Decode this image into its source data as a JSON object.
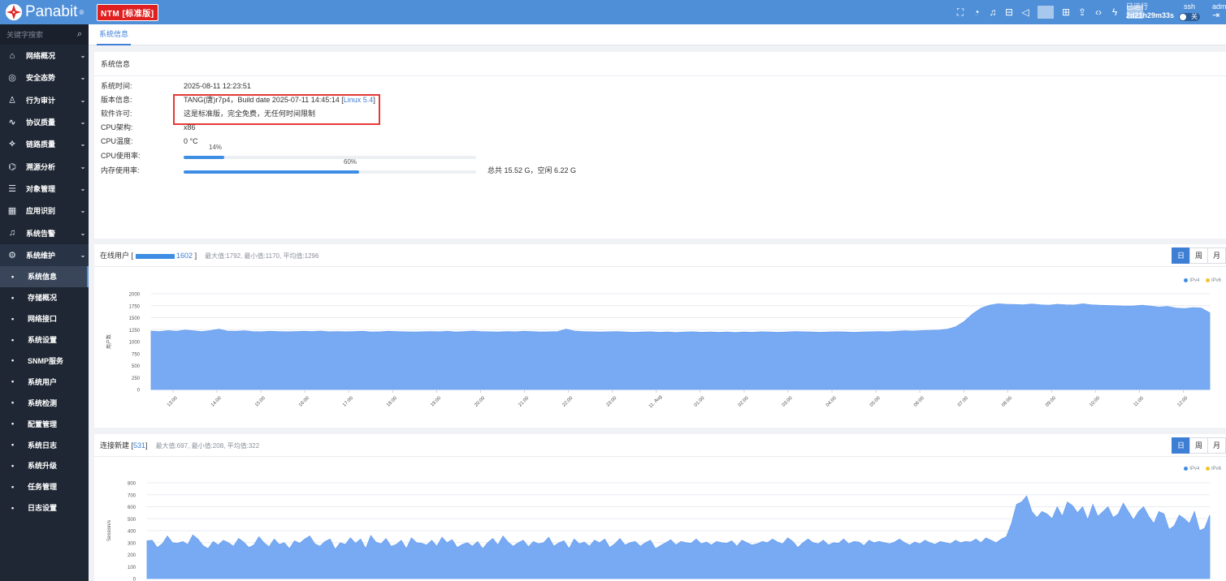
{
  "brand": {
    "name": "Panabit",
    "mark": "®",
    "edition": "NTM [标准版]"
  },
  "top": {
    "uptime_label": "已运行",
    "uptime_value": "2d21h29m33s",
    "ssh_label": "ssh",
    "ssh_toggle": "关",
    "admin_label": "adm"
  },
  "sidebar": {
    "search_placeholder": "关键字搜索",
    "items": [
      {
        "label": "网络概况",
        "icon": "home-icon"
      },
      {
        "label": "安全态势",
        "icon": "globe-icon"
      },
      {
        "label": "行为审计",
        "icon": "user-icon"
      },
      {
        "label": "协议质量",
        "icon": "pulse-icon"
      },
      {
        "label": "链路质量",
        "icon": "network-icon"
      },
      {
        "label": "溯源分析",
        "icon": "radar-icon"
      },
      {
        "label": "对象管理",
        "icon": "database-icon"
      },
      {
        "label": "应用识别",
        "icon": "apps-icon"
      },
      {
        "label": "系统告警",
        "icon": "bell-icon"
      },
      {
        "label": "系统维护",
        "icon": "gear-icon"
      }
    ],
    "subitems": [
      "系统信息",
      "存储概况",
      "网络接口",
      "系统设置",
      "SNMP服务",
      "系统用户",
      "系统检测",
      "配置管理",
      "系统日志",
      "系统升级",
      "任务管理",
      "日志设置"
    ]
  },
  "tabs": [
    "系统信息"
  ],
  "system_info": {
    "title": "系统信息",
    "labels": [
      "系统时间:",
      "版本信息:",
      "软件许可:",
      "CPU架构:",
      "CPU温度:",
      "CPU使用率:",
      "内存使用率:"
    ],
    "system_time": "2025-08-11 12:23:51",
    "version_prefix": "TANG(唐)r7p4，Build date 2025-07-11 14:45:14 [",
    "version_kernel": "Linux 5.4",
    "version_suffix": "]",
    "license": "这是标准版，完全免费，无任何时间限制",
    "cpu_arch": "x86",
    "cpu_temp": "0 °C",
    "cpu_usage": 14,
    "cpu_usage_label": "14%",
    "mem_usage": 60,
    "mem_usage_label": "60%",
    "mem_summary": "总共 15.52 G，空闲 6.22 G"
  },
  "online_users": {
    "title": "在线用户 [",
    "current": "1602",
    "close": "]",
    "stats": "最大值:1792, 最小值:1170, 平均值:1296",
    "period_buttons": [
      "日",
      "周",
      "月"
    ],
    "active_period": "日",
    "legend": [
      "IPv4",
      "IPv6"
    ],
    "ylabel": "用户数",
    "colors": {
      "ipv4": "#3d8de4",
      "ipv6": "#f4c430",
      "area": "#78aaf3"
    }
  },
  "new_connections": {
    "title": "连接新建 [",
    "current": "531",
    "close": "]",
    "stats": "最大值:697, 最小值:208, 平均值:322",
    "period_buttons": [
      "日",
      "周",
      "月"
    ],
    "active_period": "日",
    "legend": [
      "IPv4",
      "IPv6"
    ],
    "ylabel": "Session/s"
  },
  "chart_data": [
    {
      "type": "area",
      "title": "",
      "xlabel": "",
      "ylabel": "用户数",
      "ylim": [
        0,
        2000
      ],
      "y_ticks": [
        0,
        250,
        500,
        750,
        1000,
        1250,
        1500,
        1750,
        2000
      ],
      "x_ticks": [
        "13:00",
        "14:00",
        "15:00",
        "16:00",
        "17:00",
        "18:00",
        "19:00",
        "20:00",
        "21:00",
        "22:00",
        "23:00",
        "11. Aug",
        "01:00",
        "02:00",
        "03:00",
        "04:00",
        "05:00",
        "06:00",
        "07:00",
        "08:00",
        "09:00",
        "10:00",
        "11:00",
        "12:00"
      ],
      "series": [
        {
          "name": "IPv4",
          "values": [
            1220,
            1210,
            1230,
            1215,
            1240,
            1225,
            1210,
            1230,
            1260,
            1220,
            1215,
            1225,
            1210,
            1205,
            1215,
            1210,
            1205,
            1210,
            1215,
            1210,
            1220,
            1205,
            1210,
            1205,
            1210,
            1215,
            1200,
            1205,
            1215,
            1210,
            1205,
            1200,
            1205,
            1210,
            1205,
            1215,
            1200,
            1210,
            1220,
            1210,
            1205,
            1200,
            1210,
            1205,
            1215,
            1210,
            1200,
            1205,
            1210,
            1260,
            1220,
            1210,
            1205,
            1200,
            1205,
            1210,
            1200,
            1195,
            1200,
            1205,
            1195,
            1200,
            1190,
            1200,
            1205,
            1195,
            1200,
            1195,
            1200,
            1190,
            1200,
            1195,
            1205,
            1200,
            1195,
            1200,
            1210,
            1205,
            1200,
            1195,
            1200,
            1205,
            1200,
            1195,
            1200,
            1205,
            1210,
            1205,
            1215,
            1225,
            1220,
            1230,
            1235,
            1240,
            1260,
            1310,
            1420,
            1580,
            1700,
            1760,
            1790,
            1780,
            1775,
            1770,
            1785,
            1770,
            1760,
            1780,
            1770,
            1765,
            1790,
            1770,
            1760,
            1755,
            1750,
            1740,
            1745,
            1760,
            1740,
            1720,
            1735,
            1700,
            1690,
            1710,
            1700,
            1602
          ]
        },
        {
          "name": "IPv6",
          "values": []
        }
      ]
    },
    {
      "type": "area",
      "title": "",
      "xlabel": "",
      "ylabel": "Session/s",
      "ylim": [
        0,
        800
      ],
      "y_ticks": [
        0,
        100,
        200,
        300,
        400,
        500,
        600,
        700,
        800
      ],
      "x_ticks": [],
      "series": [
        {
          "name": "IPv4",
          "values": [
            315,
            320,
            260,
            290,
            355,
            300,
            295,
            310,
            285,
            365,
            330,
            275,
            250,
            310,
            280,
            320,
            300,
            270,
            335,
            305,
            260,
            280,
            350,
            300,
            265,
            330,
            285,
            300,
            250,
            315,
            295,
            330,
            355,
            290,
            270,
            310,
            330,
            245,
            300,
            285,
            340,
            295,
            330,
            250,
            360,
            305,
            290,
            335,
            270,
            285,
            320,
            250,
            340,
            300,
            295,
            280,
            320,
            270,
            345,
            300,
            325,
            260,
            285,
            300,
            270,
            310,
            250,
            300,
            335,
            280,
            355,
            305,
            270,
            300,
            320,
            265,
            310,
            290,
            300,
            345,
            270,
            300,
            315,
            250,
            330,
            290,
            305,
            270,
            320,
            300,
            330,
            260,
            290,
            335,
            280,
            300,
            310,
            270,
            300,
            320,
            250,
            275,
            300,
            325,
            280,
            310,
            300,
            295,
            330,
            290,
            305,
            280,
            310,
            300,
            295,
            315,
            270,
            320,
            300,
            280,
            290,
            310,
            300,
            330,
            305,
            290,
            340,
            310,
            260,
            300,
            330,
            300,
            290,
            320,
            280,
            300,
            295,
            330,
            290,
            310,
            305,
            275,
            320,
            300,
            310,
            300,
            290,
            305,
            330,
            300,
            280,
            305,
            290,
            320,
            300,
            285,
            310,
            300,
            290,
            320,
            300,
            310,
            305,
            330,
            300,
            340,
            320,
            300,
            330,
            350,
            460,
            620,
            640,
            690,
            560,
            510,
            560,
            540,
            500,
            600,
            520,
            640,
            610,
            550,
            600,
            490,
            620,
            520,
            560,
            600,
            510,
            540,
            630,
            560,
            490,
            560,
            600,
            520,
            460,
            560,
            540,
            410,
            440,
            530,
            500,
            460,
            560,
            400,
            420,
            531
          ]
        },
        {
          "name": "IPv6",
          "values": []
        }
      ]
    }
  ]
}
